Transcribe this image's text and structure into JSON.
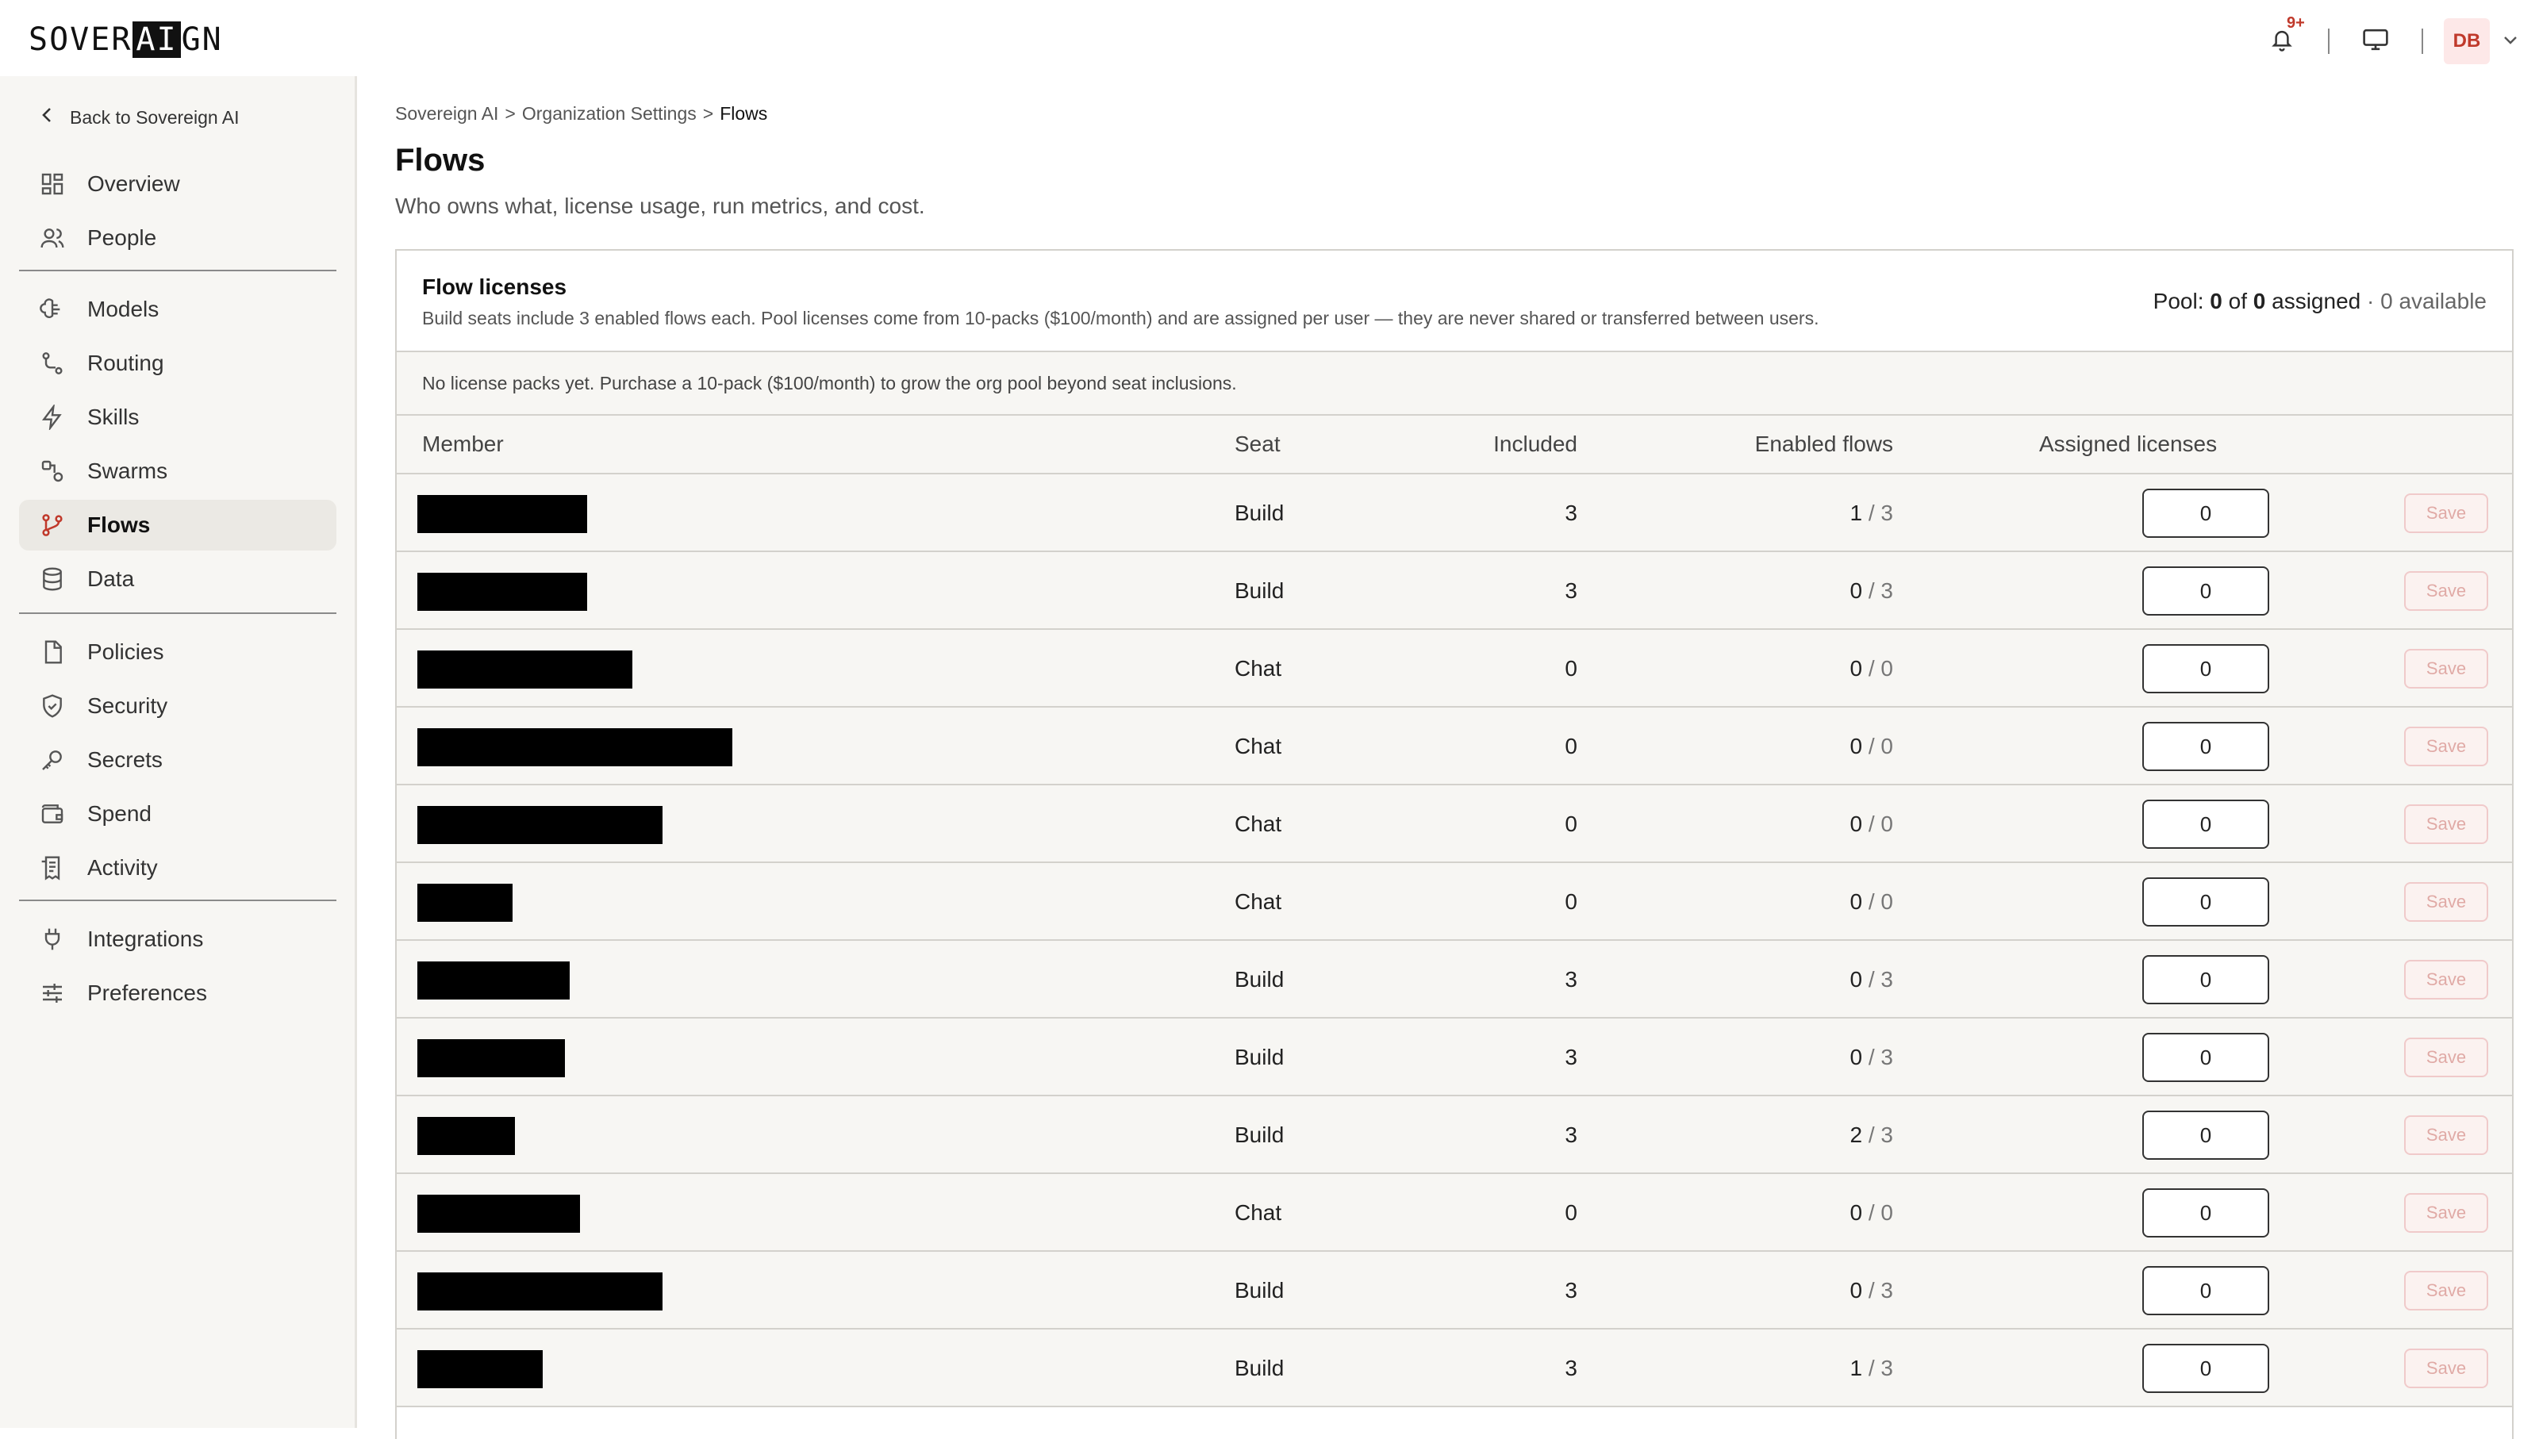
{
  "header": {
    "logo_text": "SOVERAIGN",
    "logo_prefix": "SOVER",
    "logo_ai": "AI",
    "logo_suffix": "GN",
    "notification_badge": "9+",
    "user_initials": "DB"
  },
  "sidebar": {
    "back_label": "Back to Sovereign AI",
    "groups": [
      [
        {
          "label": "Overview",
          "icon": "grid-icon"
        },
        {
          "label": "People",
          "icon": "people-icon"
        }
      ],
      [
        {
          "label": "Models",
          "icon": "brain-icon"
        },
        {
          "label": "Routing",
          "icon": "route-icon"
        },
        {
          "label": "Skills",
          "icon": "bolt-icon"
        },
        {
          "label": "Swarms",
          "icon": "swarm-icon"
        },
        {
          "label": "Flows",
          "icon": "branch-icon",
          "active": true
        },
        {
          "label": "Data",
          "icon": "database-icon"
        }
      ],
      [
        {
          "label": "Policies",
          "icon": "document-icon"
        },
        {
          "label": "Security",
          "icon": "shield-icon"
        },
        {
          "label": "Secrets",
          "icon": "key-icon"
        },
        {
          "label": "Spend",
          "icon": "wallet-icon"
        },
        {
          "label": "Activity",
          "icon": "receipt-icon"
        }
      ],
      [
        {
          "label": "Integrations",
          "icon": "plug-icon"
        },
        {
          "label": "Preferences",
          "icon": "sliders-icon"
        }
      ]
    ]
  },
  "breadcrumb": {
    "items": [
      "Sovereign AI",
      "Organization Settings",
      "Flows"
    ],
    "separator": ">"
  },
  "page": {
    "title": "Flows",
    "subtitle": "Who owns what, license usage, run metrics, and cost."
  },
  "licenses": {
    "title": "Flow licenses",
    "description": "Build seats include 3 enabled flows each. Pool licenses come from 10-packs ($100/month) and are assigned per user — they are never shared or transferred between users.",
    "pool_label": "Pool:",
    "pool_assigned": "0",
    "pool_of": "of",
    "pool_total": "0",
    "pool_assigned_word": "assigned",
    "pool_available": "· 0 available",
    "notice": "No license packs yet. Purchase a 10-pack ($100/month) to grow the org pool beyond seat inclusions."
  },
  "table": {
    "headers": {
      "member": "Member",
      "seat": "Seat",
      "included": "Included",
      "enabled": "Enabled flows",
      "assigned": "Assigned licenses"
    },
    "save_label": "Save",
    "rows": [
      {
        "redact": 0.068,
        "seat": "Build",
        "included": "3",
        "enabled": "1",
        "total": "3",
        "assigned": "0"
      },
      {
        "redact": 0.068,
        "seat": "Build",
        "included": "3",
        "enabled": "0",
        "total": "3",
        "assigned": "0"
      },
      {
        "redact": 0.086,
        "seat": "Chat",
        "included": "0",
        "enabled": "0",
        "total": "0",
        "assigned": "0"
      },
      {
        "redact": 0.126,
        "seat": "Chat",
        "included": "0",
        "enabled": "0",
        "total": "0",
        "assigned": "0"
      },
      {
        "redact": 0.098,
        "seat": "Chat",
        "included": "0",
        "enabled": "0",
        "total": "0",
        "assigned": "0"
      },
      {
        "redact": 0.038,
        "seat": "Chat",
        "included": "0",
        "enabled": "0",
        "total": "0",
        "assigned": "0"
      },
      {
        "redact": 0.061,
        "seat": "Build",
        "included": "3",
        "enabled": "0",
        "total": "3",
        "assigned": "0"
      },
      {
        "redact": 0.059,
        "seat": "Build",
        "included": "3",
        "enabled": "0",
        "total": "3",
        "assigned": "0"
      },
      {
        "redact": 0.039,
        "seat": "Build",
        "included": "3",
        "enabled": "2",
        "total": "3",
        "assigned": "0"
      },
      {
        "redact": 0.065,
        "seat": "Chat",
        "included": "0",
        "enabled": "0",
        "total": "0",
        "assigned": "0"
      },
      {
        "redact": 0.098,
        "seat": "Build",
        "included": "3",
        "enabled": "0",
        "total": "3",
        "assigned": "0"
      },
      {
        "redact": 0.05,
        "seat": "Build",
        "included": "3",
        "enabled": "1",
        "total": "3",
        "assigned": "0"
      }
    ]
  }
}
